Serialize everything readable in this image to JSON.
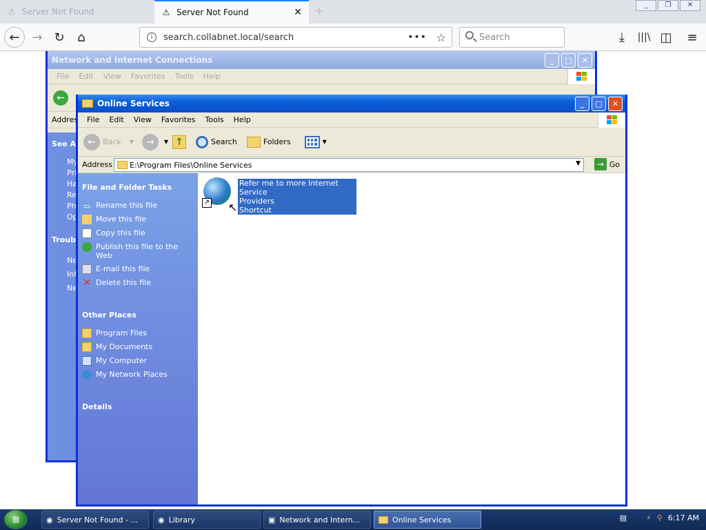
{
  "browser": {
    "tabs": [
      {
        "title": "Server Not Found",
        "active": false
      },
      {
        "title": "Server Not Found",
        "active": true
      }
    ],
    "new_tab": "+",
    "url": "search.collabnet.local/search",
    "search_placeholder": "Search",
    "url_dots": "•••"
  },
  "bg_window": {
    "title": "Network and Internet Connections",
    "menu": [
      "File",
      "Edit",
      "View",
      "Favorites",
      "Tools",
      "Help"
    ],
    "address_label": "Addres",
    "see_also": "See Also",
    "see_also_items": [
      "My",
      "Pri Ha",
      "Re",
      "Ph Op"
    ],
    "troubleshoot": "Troubl",
    "trouble_items": [
      "Ne",
      "Inf",
      "Ne"
    ]
  },
  "window": {
    "title": "Online Services",
    "menu": [
      "File",
      "Edit",
      "View",
      "Favorites",
      "Tools",
      "Help"
    ],
    "toolbar": {
      "back": "Back",
      "search": "Search",
      "folders": "Folders"
    },
    "address_label": "Address",
    "address_value": "E:\\Program Files\\Online Services",
    "go_label": "Go",
    "file_tasks_title": "File and Folder Tasks",
    "file_tasks": [
      "Rename this file",
      "Move this file",
      "Copy this file",
      "Publish this file to the Web",
      "E-mail this file",
      "Delete this file"
    ],
    "other_places_title": "Other Places",
    "other_places": [
      "Program Files",
      "My Documents",
      "My Computer",
      "My Network Places"
    ],
    "details_title": "Details",
    "file_item": {
      "line1": "Refer me to more Internet Service",
      "line2": "Providers",
      "line3": "Shortcut"
    }
  },
  "taskbar": {
    "tasks": [
      {
        "label": "Server Not Found - ...",
        "active": false
      },
      {
        "label": "Library",
        "active": false
      },
      {
        "label": "Network and Intern...",
        "active": false
      },
      {
        "label": "Online Services",
        "active": true
      }
    ],
    "clock": "6:17 AM"
  },
  "colors": {
    "xp_blue": "#0a5fd8",
    "task_pane": "#6f8fe0",
    "selection": "#316ac5"
  }
}
